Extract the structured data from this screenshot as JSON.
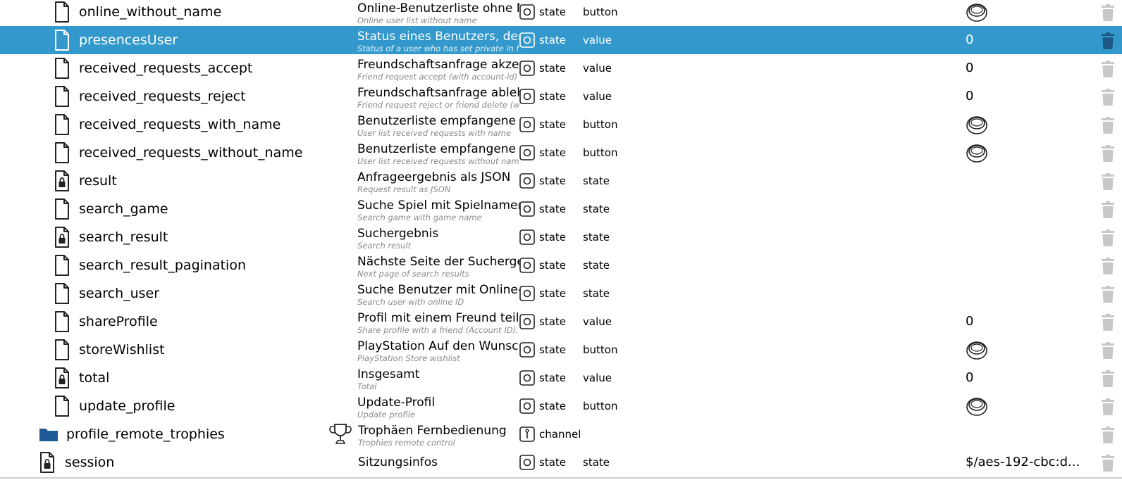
{
  "colors": {
    "selected_row": "#3399cc",
    "folder": "#1e5a96",
    "trash": "#c8c8c8",
    "subtitle": "#8a8a8a"
  },
  "rows": [
    {
      "name": "online_without_name",
      "icon": "file-icon",
      "desc": "Online-Benutzerliste ohne Name",
      "desc_sub": "Online user list without name",
      "type": "state",
      "role": "button",
      "value": "",
      "value_icon": "button-icon"
    },
    {
      "name": "presencesUser",
      "icon": "file-icon",
      "desc": "Status eines Benutzers, der in",
      "desc_sub": "Status of a user who has set private in his profile",
      "type": "state",
      "role": "value",
      "value": "0",
      "value_icon": "",
      "selected": true
    },
    {
      "name": "received_requests_accept",
      "icon": "file-icon",
      "desc": "Freundschaftsanfrage akzeptieren",
      "desc_sub": "Friend request accept (with account-id)",
      "type": "state",
      "role": "value",
      "value": "0",
      "value_icon": ""
    },
    {
      "name": "received_requests_reject",
      "icon": "file-icon",
      "desc": "Freundschaftsanfrage ablehnen",
      "desc_sub": "Friend request reject or friend delete (with account-id)",
      "type": "state",
      "role": "value",
      "value": "0",
      "value_icon": ""
    },
    {
      "name": "received_requests_with_name",
      "icon": "file-icon",
      "desc": "Benutzerliste empfangene Anfragen",
      "desc_sub": "User list received requests with name",
      "type": "state",
      "role": "button",
      "value": "",
      "value_icon": "button-icon"
    },
    {
      "name": "received_requests_without_name",
      "icon": "file-icon",
      "desc": "Benutzerliste empfangene Anfragen",
      "desc_sub": "User list received requests without name",
      "type": "state",
      "role": "button",
      "value": "",
      "value_icon": "button-icon"
    },
    {
      "name": "result",
      "icon": "locked-file-icon",
      "desc": "Anfrageergebnis als JSON",
      "desc_sub": "Request result as JSON",
      "type": "state",
      "role": "state",
      "value": "",
      "value_icon": ""
    },
    {
      "name": "search_game",
      "icon": "file-icon",
      "desc": "Suche Spiel mit Spielnamen",
      "desc_sub": "Search game with game name",
      "type": "state",
      "role": "state",
      "value": "",
      "value_icon": ""
    },
    {
      "name": "search_result",
      "icon": "locked-file-icon",
      "desc": "Suchergebnis",
      "desc_sub": "Search result",
      "type": "state",
      "role": "state",
      "value": "",
      "value_icon": ""
    },
    {
      "name": "search_result_pagination",
      "icon": "file-icon",
      "desc": "Nächste Seite der Suchergebnisse",
      "desc_sub": "Next page of search results",
      "type": "state",
      "role": "state",
      "value": "",
      "value_icon": ""
    },
    {
      "name": "search_user",
      "icon": "file-icon",
      "desc": "Suche Benutzer mit Online-ID",
      "desc_sub": "Search user with online ID",
      "type": "state",
      "role": "state",
      "value": "",
      "value_icon": ""
    },
    {
      "name": "shareProfile",
      "icon": "file-icon",
      "desc": "Profil mit einem Freund teilen",
      "desc_sub": "Share profile with a friend (Account ID). A link",
      "type": "state",
      "role": "value",
      "value": "0",
      "value_icon": ""
    },
    {
      "name": "storeWishlist",
      "icon": "file-icon",
      "desc": "PlayStation Auf den Wunschzettel",
      "desc_sub": "PlayStation Store wishlist",
      "type": "state",
      "role": "button",
      "value": "",
      "value_icon": "button-icon"
    },
    {
      "name": "total",
      "icon": "locked-file-icon",
      "desc": "Insgesamt",
      "desc_sub": "Total",
      "type": "state",
      "role": "value",
      "value": "0",
      "value_icon": ""
    },
    {
      "name": "update_profile",
      "icon": "file-icon",
      "desc": "Update-Profil",
      "desc_sub": "Update profile",
      "type": "state",
      "role": "button",
      "value": "",
      "value_icon": "button-icon"
    },
    {
      "name": "profile_remote_trophies",
      "icon": "folder-icon",
      "desc": "Trophäen Fernbedienung",
      "desc_sub": "Trophies remote control",
      "type": "channel",
      "role": "",
      "value": "",
      "value_icon": "",
      "level": 1,
      "desc_icon": "trophy-icon"
    },
    {
      "name": "session",
      "icon": "locked-file-icon",
      "desc": "Sitzungsinfos",
      "desc_sub": "",
      "type": "state",
      "role": "state",
      "value": "$/aes-192-cbc:d...",
      "value_icon": "",
      "level": 1
    }
  ]
}
